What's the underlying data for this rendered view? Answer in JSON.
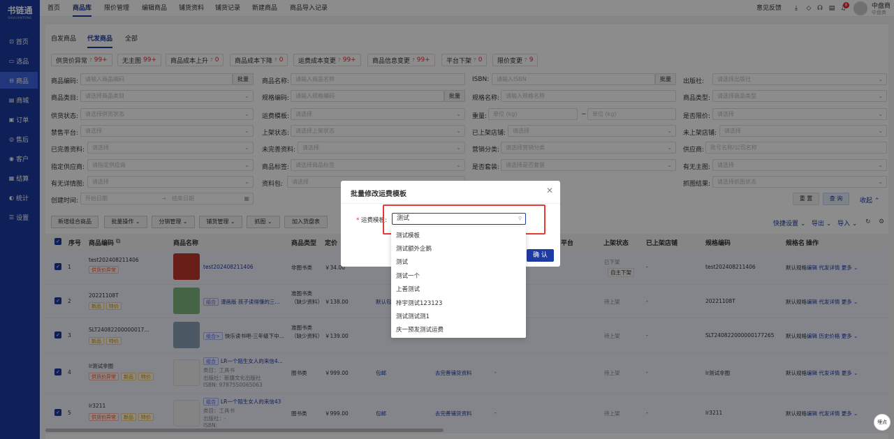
{
  "app": {
    "logo": "书链通",
    "logo_sub": "SHULIANTONG"
  },
  "sidebar": {
    "items": [
      {
        "label": "首页",
        "icon": "⊡"
      },
      {
        "label": "选品",
        "icon": "▭"
      },
      {
        "label": "商品",
        "icon": "⊟"
      },
      {
        "label": "商城",
        "icon": "▤"
      },
      {
        "label": "订单",
        "icon": "▣"
      },
      {
        "label": "售后",
        "icon": "◎"
      },
      {
        "label": "客户",
        "icon": "◉"
      },
      {
        "label": "结算",
        "icon": "▦"
      },
      {
        "label": "统计",
        "icon": "◐"
      },
      {
        "label": "设置",
        "icon": "☰"
      }
    ]
  },
  "topnav": [
    "首页",
    "商品库",
    "限价管理",
    "编辑商品",
    "铺货资料",
    "铺货记录",
    "新建商品",
    "商品导入记录"
  ],
  "topright": {
    "feedback": "意见反馈",
    "badge": "8",
    "user": "中盘商",
    "user_sub": "中盘商"
  },
  "subtabs": [
    "自发商品",
    "代发商品",
    "全部"
  ],
  "chips": [
    {
      "label": "供货价异常",
      "count": "99+"
    },
    {
      "label": "无主图",
      "count": "99+"
    },
    {
      "label": "商品成本上升",
      "count": "0"
    },
    {
      "label": "商品成本下降",
      "count": "0"
    },
    {
      "label": "运费成本变更",
      "count": "99+"
    },
    {
      "label": "商品信息变更",
      "count": "99+"
    },
    {
      "label": "平台下架",
      "count": "0"
    },
    {
      "label": "限价变更",
      "count": "9"
    }
  ],
  "filters": {
    "r1": {
      "l1": "商品编码:",
      "p1": "请输入商品编码",
      "b1": "批量",
      "l2": "商品名称:",
      "p2": "请输入商品名称",
      "l3": "ISBN:",
      "p3": "请输入ISBN",
      "b3": "批量",
      "l4": "出版社:",
      "p4": "请选择出版社"
    },
    "r2": {
      "l1": "商品类目:",
      "p1": "请选择商品类目",
      "l2": "规格编码:",
      "p2": "请输入规格编码",
      "b2": "批量",
      "l3": "规格名称:",
      "p3": "请输入规格名称",
      "l4": "商品类型:",
      "p4": "请选择商品类型"
    },
    "r3": {
      "l1": "供货状态:",
      "p1": "请选择供货状态",
      "l2": "运费模板:",
      "p2": "请选择",
      "l3": "重量:",
      "p3": "单位 (kg)",
      "sep": "~",
      "p3b": "单位 (kg)",
      "l4": "是否限价:",
      "p4": "请选择"
    },
    "r4": {
      "l1": "禁售平台:",
      "p1": "请选择",
      "l2": "上架状态:",
      "p2": "请选择上架状态",
      "l3": "已上架店铺:",
      "p3": "请选择",
      "l4": "未上架店铺:",
      "p4": "请选择"
    },
    "r5": {
      "l1": "已完善资料:",
      "p1": "请选择",
      "l2": "未完善资料:",
      "p2": "请选择",
      "l3": "营销分类:",
      "p3": "请选择营销分类",
      "l4": "供应商:",
      "p4": "账号名称/公司名称"
    },
    "r6": {
      "l1": "指定供应商:",
      "p1": "请指定供应商",
      "l2": "商品标签:",
      "p2": "请选择商品标签",
      "l3": "是否套装:",
      "p3": "请选择是否套装",
      "l4": "有无主图:",
      "p4": "请选择"
    },
    "r7": {
      "l1": "有无详情图:",
      "p1": "请选择",
      "l2": "资料包:",
      "p2": "请选择",
      "l4": "抓图结果:",
      "p4": "请选择抓图状态"
    },
    "r8": {
      "l1": "创建时间:",
      "p1": "开始日期",
      "arrow": "→",
      "p1b": "结束日期"
    },
    "reset": "重 置",
    "query": "查 询",
    "collapse": "收起"
  },
  "actions": [
    "新增组合商品",
    "批量操作",
    "分销管理",
    "铺货管理",
    "抓图",
    "加入货盘表"
  ],
  "right_actions": [
    "快捷设置",
    "导出",
    "导入"
  ],
  "table": {
    "headers": [
      "序号",
      "商品编码",
      "商品名称",
      "商品类型",
      "定价",
      "平台",
      "上架状态",
      "已上架店铺",
      "规格编码",
      "规格名",
      "操作"
    ],
    "rows": [
      {
        "no": "1",
        "code": "test202408211406",
        "tags": [
          "供货价异常"
        ],
        "name": "test202408211406",
        "type": "非图书类",
        "price": "￥34.00",
        "status": "已下架",
        "status2": "自主下架",
        "shop": "-",
        "spec": "test202408211406",
        "specname": "默认规格",
        "ops": [
          "编辑",
          "代发详情",
          "更多"
        ]
      },
      {
        "no": "2",
        "code": "20221108T",
        "tags": [
          "新品",
          "特价"
        ],
        "name": "漫画版 孩子读得懂的三...",
        "ntag": "组合",
        "type": "准图书类",
        "type2": "（缺少资料）",
        "price": "￥138.00",
        "tmpl": "默认包",
        "status": "待上架",
        "shop": "-",
        "spec": "20221108T",
        "specname": "默认规格",
        "ops": [
          "编辑",
          "代发详情",
          "更多"
        ]
      },
      {
        "no": "3",
        "code": "SLT24082200000017...",
        "tags": [
          "新品",
          "特价"
        ],
        "name": "快乐读书吧-三年级下中...",
        "ntag": "组合>",
        "type": "准图书类",
        "type2": "（缺少资料）",
        "price": "￥139.00",
        "status": "待上架",
        "shop": "-",
        "spec": "SLT240822000000177265",
        "specname": "默认规格",
        "ops": [
          "编辑",
          "历史价格",
          "更多"
        ]
      },
      {
        "no": "4",
        "code": "lr测试非图",
        "tags": [
          "供货价异常",
          "新品",
          "特价"
        ],
        "name": "LR一个陌生女人的来信4...",
        "ntag": "组合",
        "cat": "类目：工具书",
        "pub": "出版社：新疆文化出版社",
        "isbn": "ISBN: 9787550065063",
        "type": "图书类",
        "price": "￥999.00",
        "tmpl": "包邮",
        "info": "去完善铺货资料",
        "status": "待上架",
        "shop": "-",
        "spec": "lr测试非图",
        "specname": "默认规格",
        "ops": [
          "编辑",
          "代发详情",
          "更多"
        ]
      },
      {
        "no": "5",
        "code": "lr3211",
        "tags": [
          "供货价异常",
          "新品",
          "特价"
        ],
        "name": "LR一个陌生女人的来信43",
        "ntag": "组合",
        "cat": "类目：工具书",
        "pub": "出版社：-",
        "isbn": "ISBN:",
        "type": "图书类",
        "price": "￥999.00",
        "tmpl": "包邮",
        "info": "去完善铺货资料",
        "status": "待上架",
        "shop": "-",
        "spec": "lr3211",
        "specname": "默认规格",
        "ops": [
          "编辑",
          "代发详情",
          "更多"
        ]
      }
    ]
  },
  "modal": {
    "title": "批量修改运费模板",
    "label": "运费模板:",
    "value": "测试",
    "ok": "确 认",
    "options": [
      "测试模板",
      "测试额外企鹅",
      "测试",
      "测试一个",
      "上善测试",
      "梓宇测试123123",
      "测试测试测1",
      "庆一预发测试运费"
    ]
  },
  "fab": "埋点",
  "colors": {
    "primary": "#1d3ba3",
    "sidebar": "#1d3ba3",
    "danger": "#f5222d"
  }
}
